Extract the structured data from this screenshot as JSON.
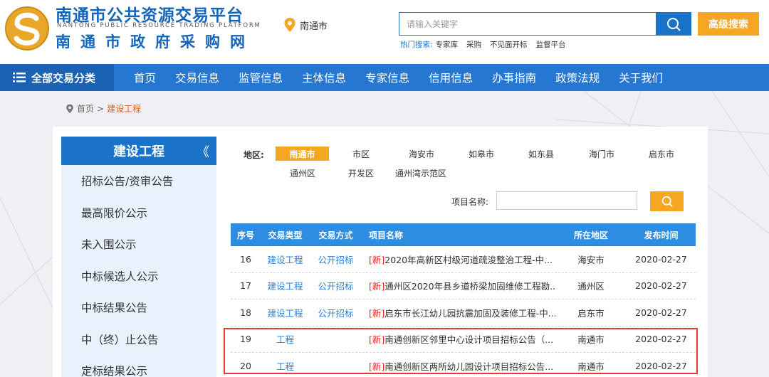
{
  "header": {
    "brand_cn": "南通市公共资源交易平台",
    "brand_en": "NANTONG PUBLIC RESOURCE TRADING PLATFORM",
    "brand_sub": "南通市政府采购网",
    "location": "南通市",
    "search_placeholder": "请输入关键字",
    "advanced_search": "高级搜索",
    "hot_label": "热门搜索:",
    "hot_items": [
      "专家库",
      "采购",
      "不见面开标",
      "监督平台"
    ]
  },
  "nav": {
    "all_label": "全部交易分类",
    "items": [
      "首页",
      "交易信息",
      "监管信息",
      "主体信息",
      "专家信息",
      "信用信息",
      "办事指南",
      "政策法规",
      "关于我们"
    ]
  },
  "breadcrumb": {
    "home": "首页",
    "separator": ">",
    "current": "建设工程"
  },
  "sidebar": {
    "title": "建设工程",
    "collapse_glyph": "《",
    "items": [
      "招标公告/资审公告",
      "最高限价公示",
      "未入围公示",
      "中标候选人公示",
      "中标结果公告",
      "中（终）止公告",
      "定标结果公示"
    ]
  },
  "filter": {
    "region_label": "地区:",
    "regions": [
      "南通市",
      "市区",
      "海安市",
      "如皋市",
      "如东县",
      "海门市",
      "启东市",
      "通州区",
      "开发区",
      "通州湾示范区"
    ],
    "active_region": "南通市",
    "project_label": "项目名称:",
    "project_value": ""
  },
  "table": {
    "headers": [
      "序号",
      "交易类型",
      "交易方式",
      "项目名称",
      "所在地区",
      "发布时间"
    ],
    "new_tag": "[新]",
    "rows": [
      {
        "no": "16",
        "type": "建设工程",
        "method": "公开招标",
        "name": "2020年高新区村级河道疏浚整治工程-中...",
        "region": "海安市",
        "date": "2020-02-27"
      },
      {
        "no": "17",
        "type": "建设工程",
        "method": "公开招标",
        "name": "通州区2020年县乡道桥梁加固维修工程勘...",
        "region": "通州区",
        "date": "2020-02-27"
      },
      {
        "no": "18",
        "type": "建设工程",
        "method": "公开招标",
        "name": "启东市长江幼儿园抗震加固及装修工程-中...",
        "region": "启东市",
        "date": "2020-02-27"
      },
      {
        "no": "19",
        "type": "工程",
        "method": "",
        "name": "南通创新区邻里中心设计项目招标公告（...",
        "region": "南通市",
        "date": "2020-02-27"
      },
      {
        "no": "20",
        "type": "工程",
        "method": "",
        "name": "南通创新区两所幼儿园设计项目招标公告...",
        "region": "南通市",
        "date": "2020-02-27"
      }
    ]
  },
  "colors": {
    "primary": "#2577d1",
    "accent": "#f5a623",
    "new_tag": "#e2231a",
    "highlight_border": "#e53935"
  }
}
